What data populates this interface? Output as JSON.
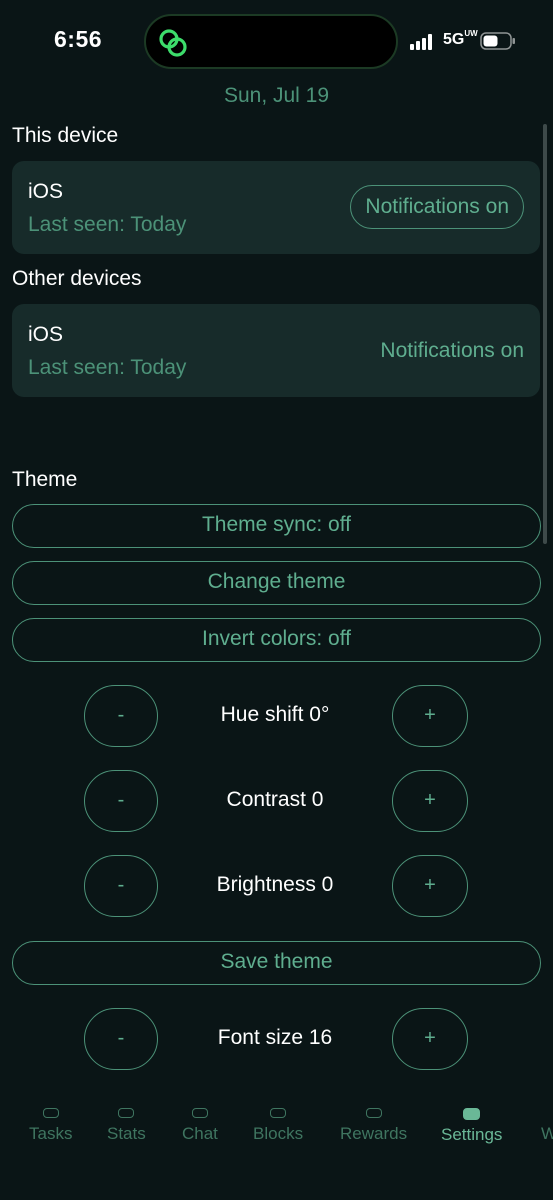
{
  "status_bar": {
    "time": "6:56",
    "network": "5G",
    "network_suffix": "UW"
  },
  "header": {
    "date": "Sun, Jul 19"
  },
  "this_device": {
    "section_label": "This device",
    "name": "iOS",
    "last_seen": "Last seen: Today",
    "notifications_label": "Notifications on"
  },
  "other_devices": {
    "section_label": "Other devices",
    "items": [
      {
        "name": "iOS",
        "last_seen": "Last seen: Today",
        "notifications_label": "Notifications on"
      }
    ]
  },
  "theme": {
    "section_label": "Theme",
    "sync_label": "Theme sync: off",
    "change_label": "Change theme",
    "invert_label": "Invert colors: off",
    "hue_label": "Hue shift 0°",
    "contrast_label": "Contrast 0",
    "brightness_label": "Brightness 0",
    "save_label": "Save theme",
    "font_size_label": "Font size 16",
    "minus_label": "-",
    "plus_label": "+"
  },
  "tabs": [
    {
      "label": "Tasks",
      "active": false
    },
    {
      "label": "Stats",
      "active": false
    },
    {
      "label": "Chat",
      "active": false
    },
    {
      "label": "Blocks",
      "active": false
    },
    {
      "label": "Rewards",
      "active": false
    },
    {
      "label": "Settings",
      "active": true
    },
    {
      "label": "W",
      "active": false
    }
  ],
  "colors": {
    "background": "#0a1516",
    "card": "#172b2a",
    "accent": "#4c9278",
    "accent_text": "#5fae8f"
  },
  "icons": {
    "island": "link-rings-icon",
    "signal": "cellular-signal-icon",
    "battery": "battery-icon"
  }
}
